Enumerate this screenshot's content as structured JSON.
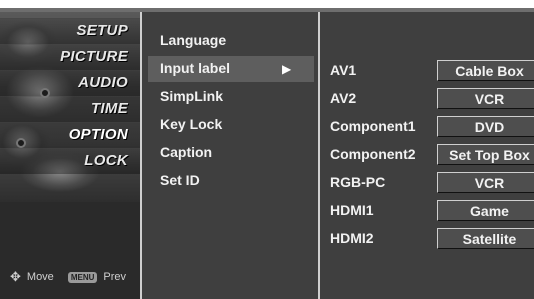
{
  "left_menu": {
    "items": [
      {
        "label": "SETUP"
      },
      {
        "label": "PICTURE"
      },
      {
        "label": "AUDIO"
      },
      {
        "label": "TIME"
      },
      {
        "label": "OPTION"
      },
      {
        "label": "LOCK"
      }
    ],
    "active": "OPTION",
    "footer": {
      "move_label": "Move",
      "menu_key": "MENU",
      "prev_label": "Prev"
    }
  },
  "submenu": {
    "items": [
      {
        "label": "Language"
      },
      {
        "label": "Input label"
      },
      {
        "label": "SimpLink"
      },
      {
        "label": "Key Lock"
      },
      {
        "label": "Caption"
      },
      {
        "label": "Set ID"
      }
    ],
    "selected": "Input label",
    "arrow": "▶"
  },
  "input_labels": [
    {
      "source": "AV1",
      "value": "Cable Box"
    },
    {
      "source": "AV2",
      "value": "VCR"
    },
    {
      "source": "Component1",
      "value": "DVD"
    },
    {
      "source": "Component2",
      "value": "Set Top Box"
    },
    {
      "source": "RGB-PC",
      "value": "VCR"
    },
    {
      "source": "HDMI1",
      "value": "Game"
    },
    {
      "source": "HDMI2",
      "value": "Satellite"
    }
  ]
}
